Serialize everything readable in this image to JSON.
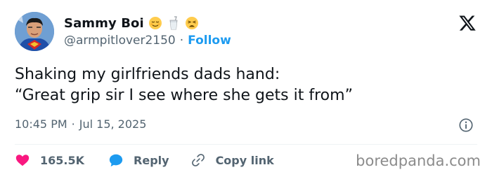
{
  "author": {
    "display_name": "Sammy Boi",
    "handle": "@armpitlover2150",
    "separator": "·",
    "follow_label": "Follow",
    "name_emojis": [
      "relieved-face-icon",
      "cup-with-straw-icon",
      "weary-face-icon"
    ]
  },
  "tweet": {
    "lines": [
      "Shaking my girlfriends dads hand:",
      "“Great grip sir I see where she gets it from”"
    ],
    "time": "10:45 PM",
    "separator": "·",
    "date": "Jul 15, 2025"
  },
  "actions": {
    "like_count": "165.5K",
    "reply_label": "Reply",
    "copy_link_label": "Copy link"
  },
  "watermark": "boredpanda.com",
  "colors": {
    "link_blue": "#1d9bf0",
    "heart_red": "#f91880",
    "muted_text": "#536471",
    "primary_text": "#0f1419"
  }
}
